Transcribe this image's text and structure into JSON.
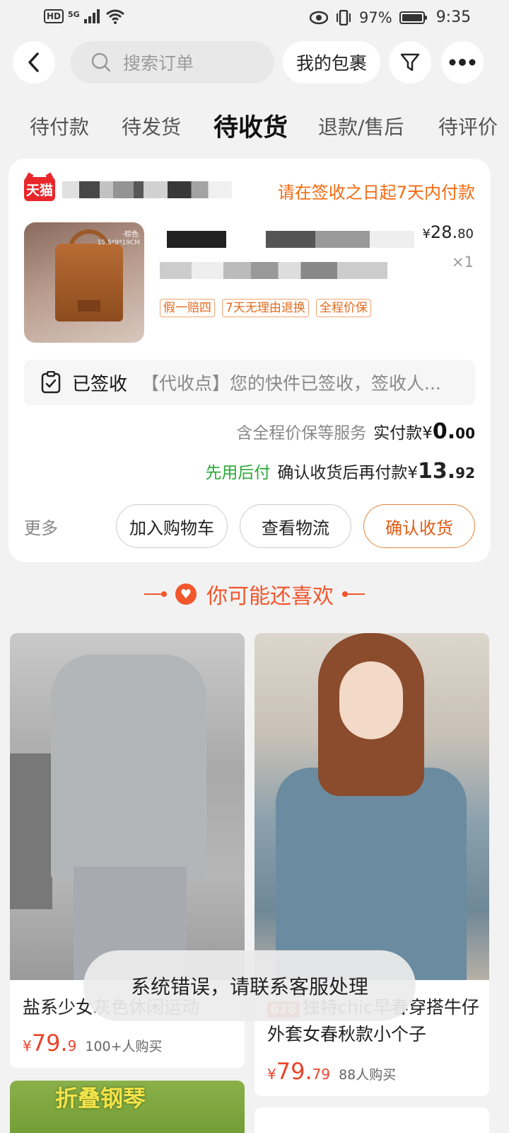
{
  "status_bar": {
    "hd": "HD",
    "network": "5G",
    "battery": "97%",
    "time": "9:35"
  },
  "header": {
    "search_placeholder": "搜索订单",
    "my_packages": "我的包裹"
  },
  "tabs": [
    {
      "label": "待付款"
    },
    {
      "label": "待发货"
    },
    {
      "label": "待收货"
    },
    {
      "label": "退款/售后"
    },
    {
      "label": "待评价"
    }
  ],
  "active_tab": "待收货",
  "order": {
    "store_badge": "天猫",
    "pay_notice": "请在签收之日起7天内付款",
    "product_img_tag": "·棕色",
    "product_img_size": "15.5*9*19CM",
    "price": {
      "yen": "¥",
      "int": "28.",
      "dec": "80"
    },
    "quantity": "×1",
    "tags": [
      "假一赔四",
      "7天无理由退换",
      "全程价保"
    ],
    "logistics": {
      "status": "已签收",
      "text": "【代收点】您的快件已签收，签收人..."
    },
    "service_note": "含全程价保等服务",
    "paid_label": "实付款",
    "paid_amount": {
      "yen": "¥",
      "int": "0.",
      "dec": "00"
    },
    "later_pay": "先用后付",
    "later_pay_note": "确认收货后再付款",
    "later_amount": {
      "yen": "¥",
      "int": "13.",
      "dec": "92"
    },
    "more": "更多",
    "buttons": {
      "cart": "加入购物车",
      "track": "查看物流",
      "confirm": "确认收货"
    }
  },
  "recommend": {
    "title": "你可能还喜欢",
    "items": [
      {
        "name": "盐系少女灰色休闲运动",
        "price": {
          "yen": "¥",
          "int": "79.",
          "dec": "9"
        },
        "sold": "100+人购买"
      },
      {
        "badge": "618",
        "name": "独特chic早春穿搭牛仔外套女春秋款小个子",
        "price": {
          "yen": "¥",
          "int": "79.",
          "dec": "79"
        },
        "sold": "88人购买"
      },
      {
        "name": "折叠钢琴"
      }
    ]
  },
  "toast": "系统错误，请联系客服处理",
  "colors": {
    "accent": "#f26b13",
    "price_red": "#e8452c",
    "green": "#2aa838",
    "tmall_red": "#e8272b"
  }
}
